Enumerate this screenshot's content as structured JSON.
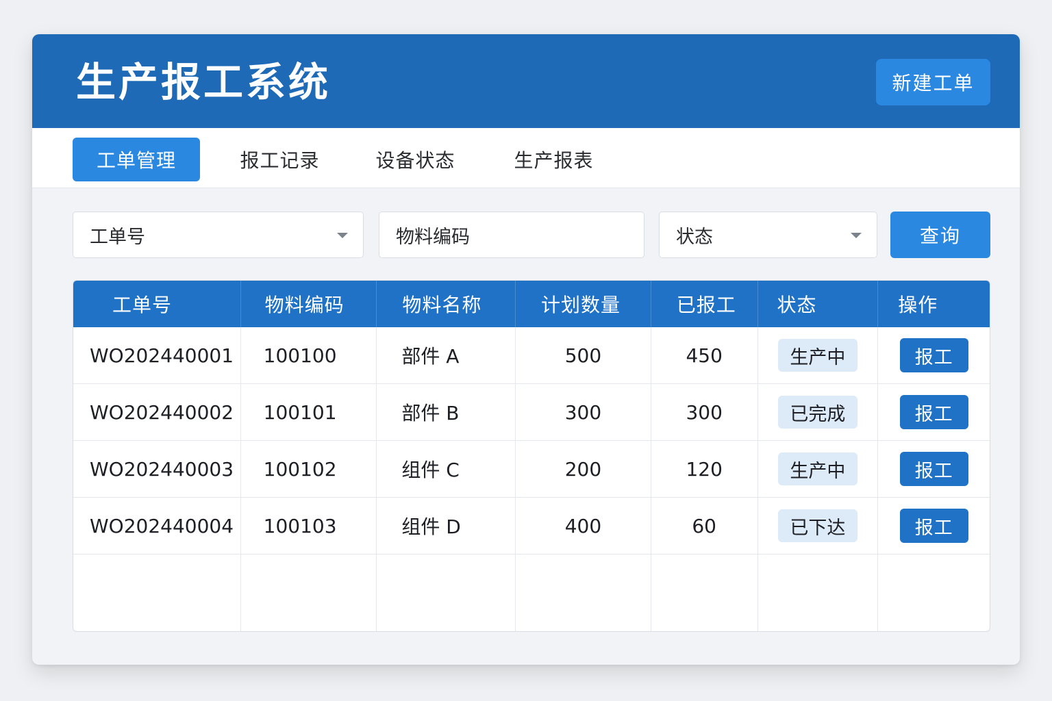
{
  "header": {
    "title": "生产报工系统",
    "new_button": "新建工单"
  },
  "tabs": [
    {
      "label": "工单管理",
      "active": true
    },
    {
      "label": "报工记录",
      "active": false
    },
    {
      "label": "设备状态",
      "active": false
    },
    {
      "label": "生产报表",
      "active": false
    }
  ],
  "filters": {
    "order_no": "工单号",
    "material_code": "物料编码",
    "status": "状态",
    "query_button": "查询"
  },
  "table": {
    "columns": [
      "工单号",
      "物料编码",
      "物料名称",
      "计划数量",
      "已报工",
      "状态",
      "操作"
    ],
    "rows": [
      {
        "order_no": "WO202440001",
        "material_code": "100100",
        "material_name": "部件 A",
        "planned_qty": "500",
        "reported_qty": "450",
        "status": "生产中",
        "action": "报工"
      },
      {
        "order_no": "WO202440002",
        "material_code": "100101",
        "material_name": "部件 B",
        "planned_qty": "300",
        "reported_qty": "300",
        "status": "已完成",
        "action": "报工"
      },
      {
        "order_no": "WO202440003",
        "material_code": "100102",
        "material_name": "组件 C",
        "planned_qty": "200",
        "reported_qty": "120",
        "status": "生产中",
        "action": "报工"
      },
      {
        "order_no": "WO202440004",
        "material_code": "100103",
        "material_name": "组件 D",
        "planned_qty": "400",
        "reported_qty": "60",
        "status": "已下达",
        "action": "报工"
      }
    ]
  },
  "colors": {
    "header": "#1e6ab6",
    "accent": "#2b88e0",
    "table_header": "#1f72c6",
    "badge": "#ddeaf7"
  }
}
